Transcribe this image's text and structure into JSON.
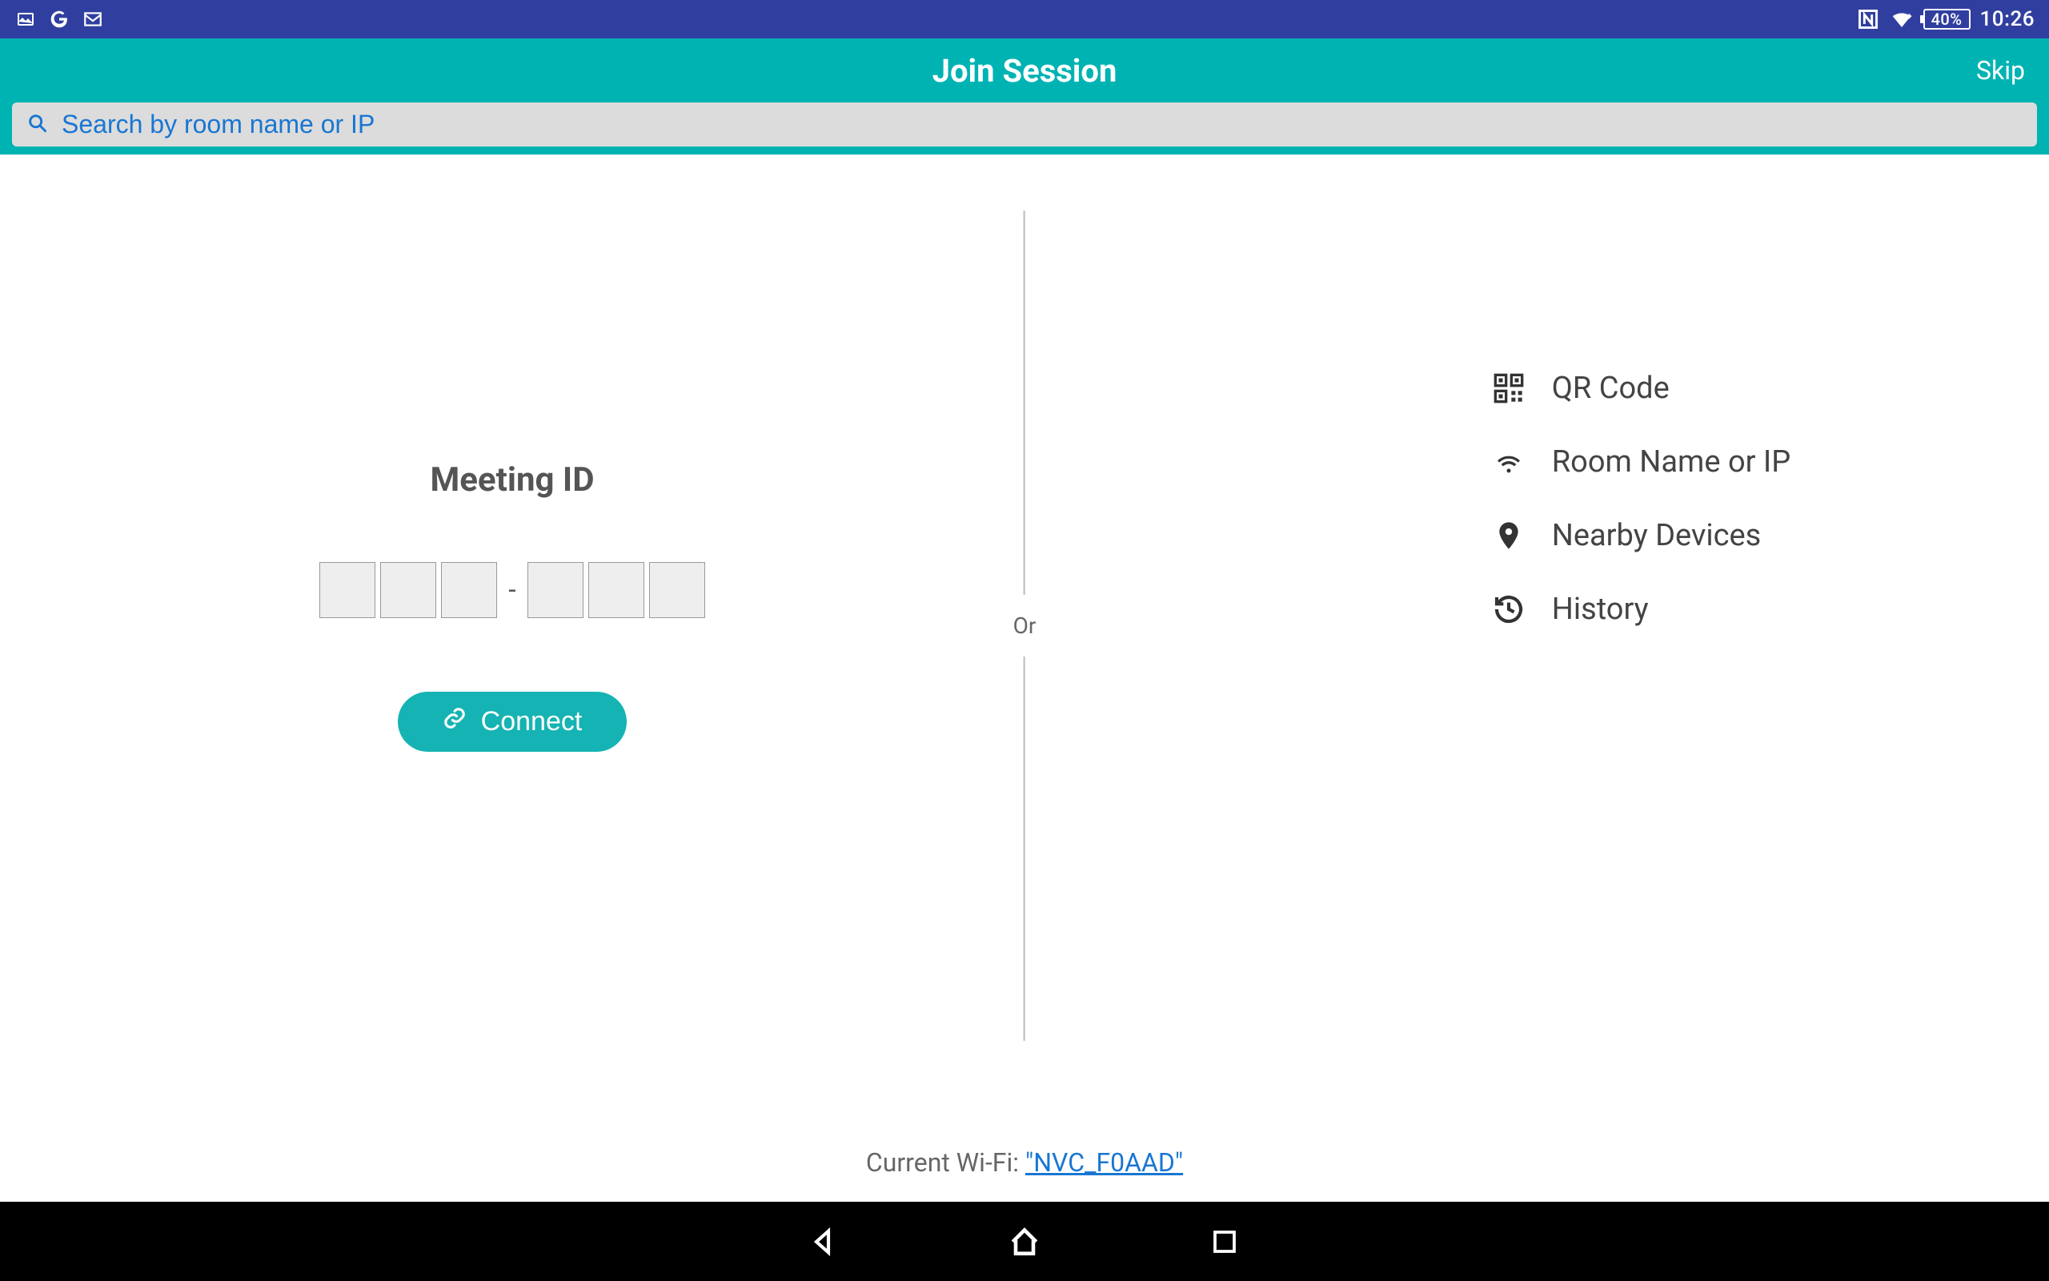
{
  "status": {
    "battery": "40%",
    "time": "10:26"
  },
  "header": {
    "title": "Join Session",
    "skip": "Skip",
    "search_placeholder": "Search by room name or IP"
  },
  "left": {
    "meeting_label": "Meeting ID",
    "dash": "-",
    "connect": "Connect"
  },
  "divider": {
    "or": "Or"
  },
  "right": {
    "options": [
      {
        "label": "QR Code"
      },
      {
        "label": "Room Name or IP"
      },
      {
        "label": "Nearby Devices"
      },
      {
        "label": "History"
      }
    ]
  },
  "wifi": {
    "prefix": "Current Wi-Fi: ",
    "ssid": "\"NVC_F0AAD\""
  }
}
